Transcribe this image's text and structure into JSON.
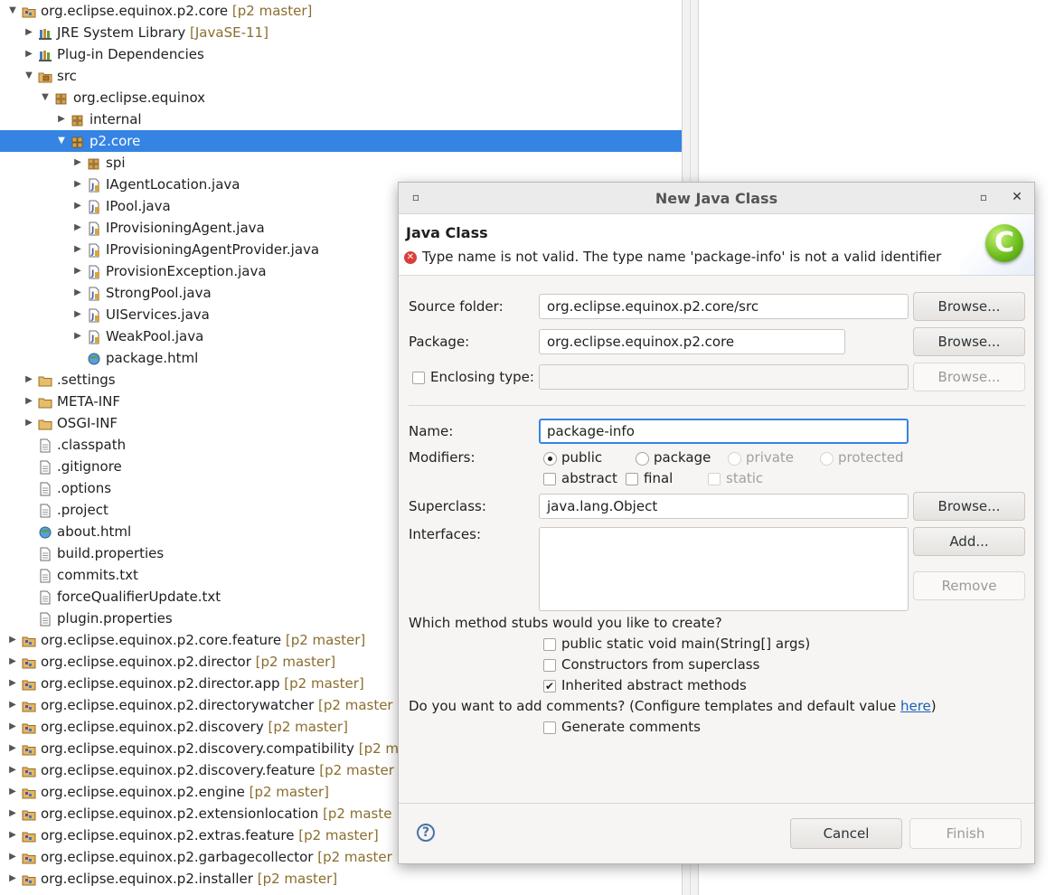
{
  "tree": {
    "rows": [
      {
        "label": "org.eclipse.equinox.p2.core",
        "decoration": "[p2 master]",
        "icon": "project-icon",
        "twisty": "expanded"
      },
      {
        "label": "JRE System Library",
        "decoration": "[JavaSE-11]",
        "icon": "library-icon",
        "twisty": "collapsed"
      },
      {
        "label": "Plug-in Dependencies",
        "decoration": "",
        "icon": "library-icon",
        "twisty": "collapsed"
      },
      {
        "label": "src",
        "decoration": "",
        "icon": "source-folder-icon",
        "twisty": "expanded"
      },
      {
        "label": "org.eclipse.equinox",
        "decoration": "",
        "icon": "package-icon",
        "twisty": "expanded"
      },
      {
        "label": "internal",
        "decoration": "",
        "icon": "package-icon",
        "twisty": "collapsed"
      },
      {
        "label": "p2.core",
        "decoration": "",
        "icon": "package-icon",
        "twisty": "expanded"
      },
      {
        "label": "spi",
        "decoration": "",
        "icon": "package-icon",
        "twisty": "collapsed"
      },
      {
        "label": "IAgentLocation.java",
        "decoration": "",
        "icon": "java-file-icon",
        "twisty": "collapsed"
      },
      {
        "label": "IPool.java",
        "decoration": "",
        "icon": "java-file-icon",
        "twisty": "collapsed"
      },
      {
        "label": "IProvisioningAgent.java",
        "decoration": "",
        "icon": "java-file-icon",
        "twisty": "collapsed"
      },
      {
        "label": "IProvisioningAgentProvider.java",
        "decoration": "",
        "icon": "java-file-icon",
        "twisty": "collapsed"
      },
      {
        "label": "ProvisionException.java",
        "decoration": "",
        "icon": "java-file-icon",
        "twisty": "collapsed"
      },
      {
        "label": "StrongPool.java",
        "decoration": "",
        "icon": "java-file-icon",
        "twisty": "collapsed"
      },
      {
        "label": "UIServices.java",
        "decoration": "",
        "icon": "java-file-icon",
        "twisty": "collapsed"
      },
      {
        "label": "WeakPool.java",
        "decoration": "",
        "icon": "java-file-icon",
        "twisty": "collapsed"
      },
      {
        "label": "package.html",
        "decoration": "",
        "icon": "html-file-icon",
        "twisty": "none"
      },
      {
        "label": ".settings",
        "decoration": "",
        "icon": "folder-icon",
        "twisty": "collapsed"
      },
      {
        "label": "META-INF",
        "decoration": "",
        "icon": "folder-icon",
        "twisty": "collapsed"
      },
      {
        "label": "OSGI-INF",
        "decoration": "",
        "icon": "folder-icon",
        "twisty": "collapsed"
      },
      {
        "label": ".classpath",
        "decoration": "",
        "icon": "file-icon",
        "twisty": "none"
      },
      {
        "label": ".gitignore",
        "decoration": "",
        "icon": "file-icon",
        "twisty": "none"
      },
      {
        "label": ".options",
        "decoration": "",
        "icon": "file-icon",
        "twisty": "none"
      },
      {
        "label": ".project",
        "decoration": "",
        "icon": "file-icon",
        "twisty": "none"
      },
      {
        "label": "about.html",
        "decoration": "",
        "icon": "html-file-icon",
        "twisty": "none"
      },
      {
        "label": "build.properties",
        "decoration": "",
        "icon": "file-icon",
        "twisty": "none"
      },
      {
        "label": "commits.txt",
        "decoration": "",
        "icon": "file-icon",
        "twisty": "none"
      },
      {
        "label": "forceQualifierUpdate.txt",
        "decoration": "",
        "icon": "file-icon",
        "twisty": "none"
      },
      {
        "label": "plugin.properties",
        "decoration": "",
        "icon": "file-icon",
        "twisty": "none"
      },
      {
        "label": "org.eclipse.equinox.p2.core.feature",
        "decoration": "[p2 master]",
        "icon": "project-icon",
        "twisty": "collapsed"
      },
      {
        "label": "org.eclipse.equinox.p2.director",
        "decoration": "[p2 master]",
        "icon": "project-icon",
        "twisty": "collapsed"
      },
      {
        "label": "org.eclipse.equinox.p2.director.app",
        "decoration": "[p2 master]",
        "icon": "project-icon",
        "twisty": "collapsed"
      },
      {
        "label": "org.eclipse.equinox.p2.directorywatcher",
        "decoration": "[p2 master",
        "icon": "project-icon",
        "twisty": "collapsed"
      },
      {
        "label": "org.eclipse.equinox.p2.discovery",
        "decoration": "[p2 master]",
        "icon": "project-icon",
        "twisty": "collapsed"
      },
      {
        "label": "org.eclipse.equinox.p2.discovery.compatibility",
        "decoration": "[p2 m",
        "icon": "project-icon",
        "twisty": "collapsed"
      },
      {
        "label": "org.eclipse.equinox.p2.discovery.feature",
        "decoration": "[p2 master",
        "icon": "project-icon",
        "twisty": "collapsed"
      },
      {
        "label": "org.eclipse.equinox.p2.engine",
        "decoration": "[p2 master]",
        "icon": "project-icon",
        "twisty": "collapsed"
      },
      {
        "label": "org.eclipse.equinox.p2.extensionlocation",
        "decoration": "[p2 maste",
        "icon": "project-icon",
        "twisty": "collapsed"
      },
      {
        "label": "org.eclipse.equinox.p2.extras.feature",
        "decoration": "[p2 master]",
        "icon": "project-icon",
        "twisty": "collapsed"
      },
      {
        "label": "org.eclipse.equinox.p2.garbagecollector",
        "decoration": "[p2 master",
        "icon": "project-icon",
        "twisty": "collapsed"
      },
      {
        "label": "org.eclipse.equinox.p2.installer",
        "decoration": "[p2 master]",
        "icon": "project-icon",
        "twisty": "collapsed"
      }
    ]
  },
  "dialog": {
    "title": "New Java Class",
    "header_title": "Java Class",
    "error_message": "Type name is not valid. The type name 'package-info' is not a valid identifier",
    "wizard_icon_letter": "C",
    "source_folder": {
      "label": "Source folder:",
      "value": "org.eclipse.equinox.p2.core/src",
      "browse": "Browse..."
    },
    "package": {
      "label": "Package:",
      "value": "org.eclipse.equinox.p2.core",
      "browse": "Browse..."
    },
    "enclosing": {
      "label": "Enclosing type:",
      "value": "",
      "browse": "Browse..."
    },
    "name": {
      "label": "Name:",
      "value": "package-info"
    },
    "modifiers": {
      "label": "Modifiers:",
      "public": "public",
      "package": "package",
      "private": "private",
      "protected": "protected",
      "abstract": "abstract",
      "final": "final",
      "static": "static"
    },
    "superclass": {
      "label": "Superclass:",
      "value": "java.lang.Object",
      "browse": "Browse..."
    },
    "interfaces": {
      "label": "Interfaces:",
      "add": "Add...",
      "remove": "Remove"
    },
    "stubs": {
      "question": "Which method stubs would you like to create?",
      "main": "public static void main(String[] args)",
      "constructors": "Constructors from superclass",
      "inherited": "Inherited abstract methods"
    },
    "comments": {
      "question_before": "Do you want to add comments? (Configure templates and default value ",
      "link": "here",
      "question_after": ")",
      "generate": "Generate comments"
    },
    "buttons": {
      "cancel": "Cancel",
      "finish": "Finish"
    }
  }
}
